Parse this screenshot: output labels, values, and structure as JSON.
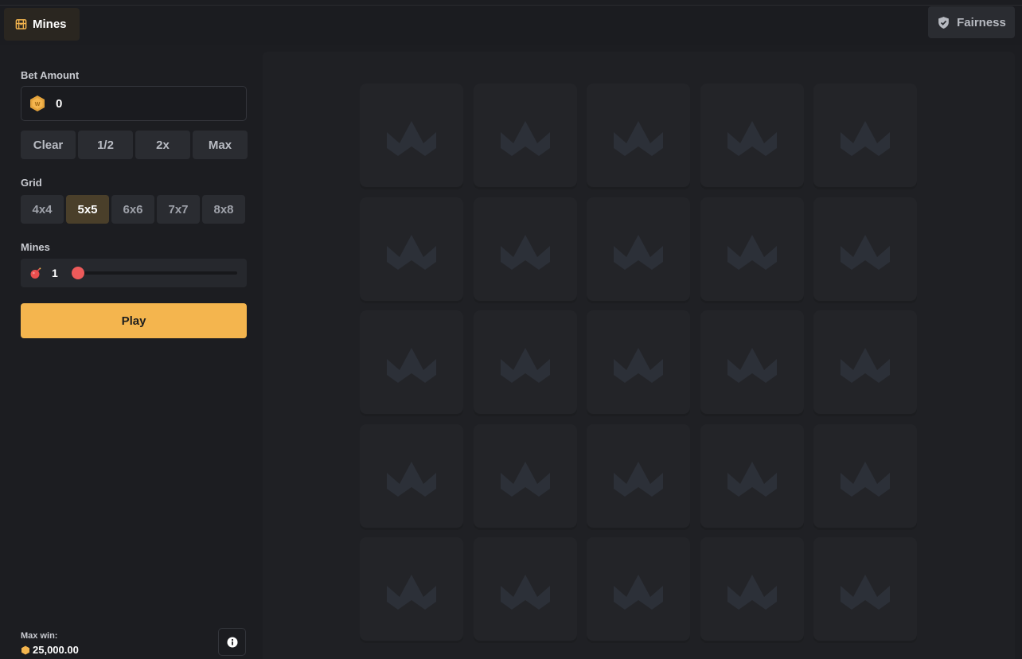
{
  "header": {
    "game_title": "Mines",
    "fairness_label": "Fairness"
  },
  "panel": {
    "bet_amount_label": "Bet Amount",
    "bet_value": "0",
    "quick_buttons": [
      "Clear",
      "1/2",
      "2x",
      "Max"
    ],
    "grid_label": "Grid",
    "grid_options": [
      "4x4",
      "5x5",
      "6x6",
      "7x7",
      "8x8"
    ],
    "grid_selected": "5x5",
    "mines_label": "Mines",
    "mines_value": "1",
    "mines_slider_fraction": 0.0,
    "play_label": "Play",
    "max_win_label": "Max win:",
    "max_win_value": "25,000.00"
  },
  "board": {
    "columns": 5,
    "rows": 5,
    "tile_icon": "crown-logo-icon"
  },
  "colors": {
    "accent": "#f4b54e",
    "selected_grid": "#4a3f2a",
    "mine_knob": "#ec5a5a",
    "tile": "#232428",
    "tile_icon": "#2c3038"
  }
}
